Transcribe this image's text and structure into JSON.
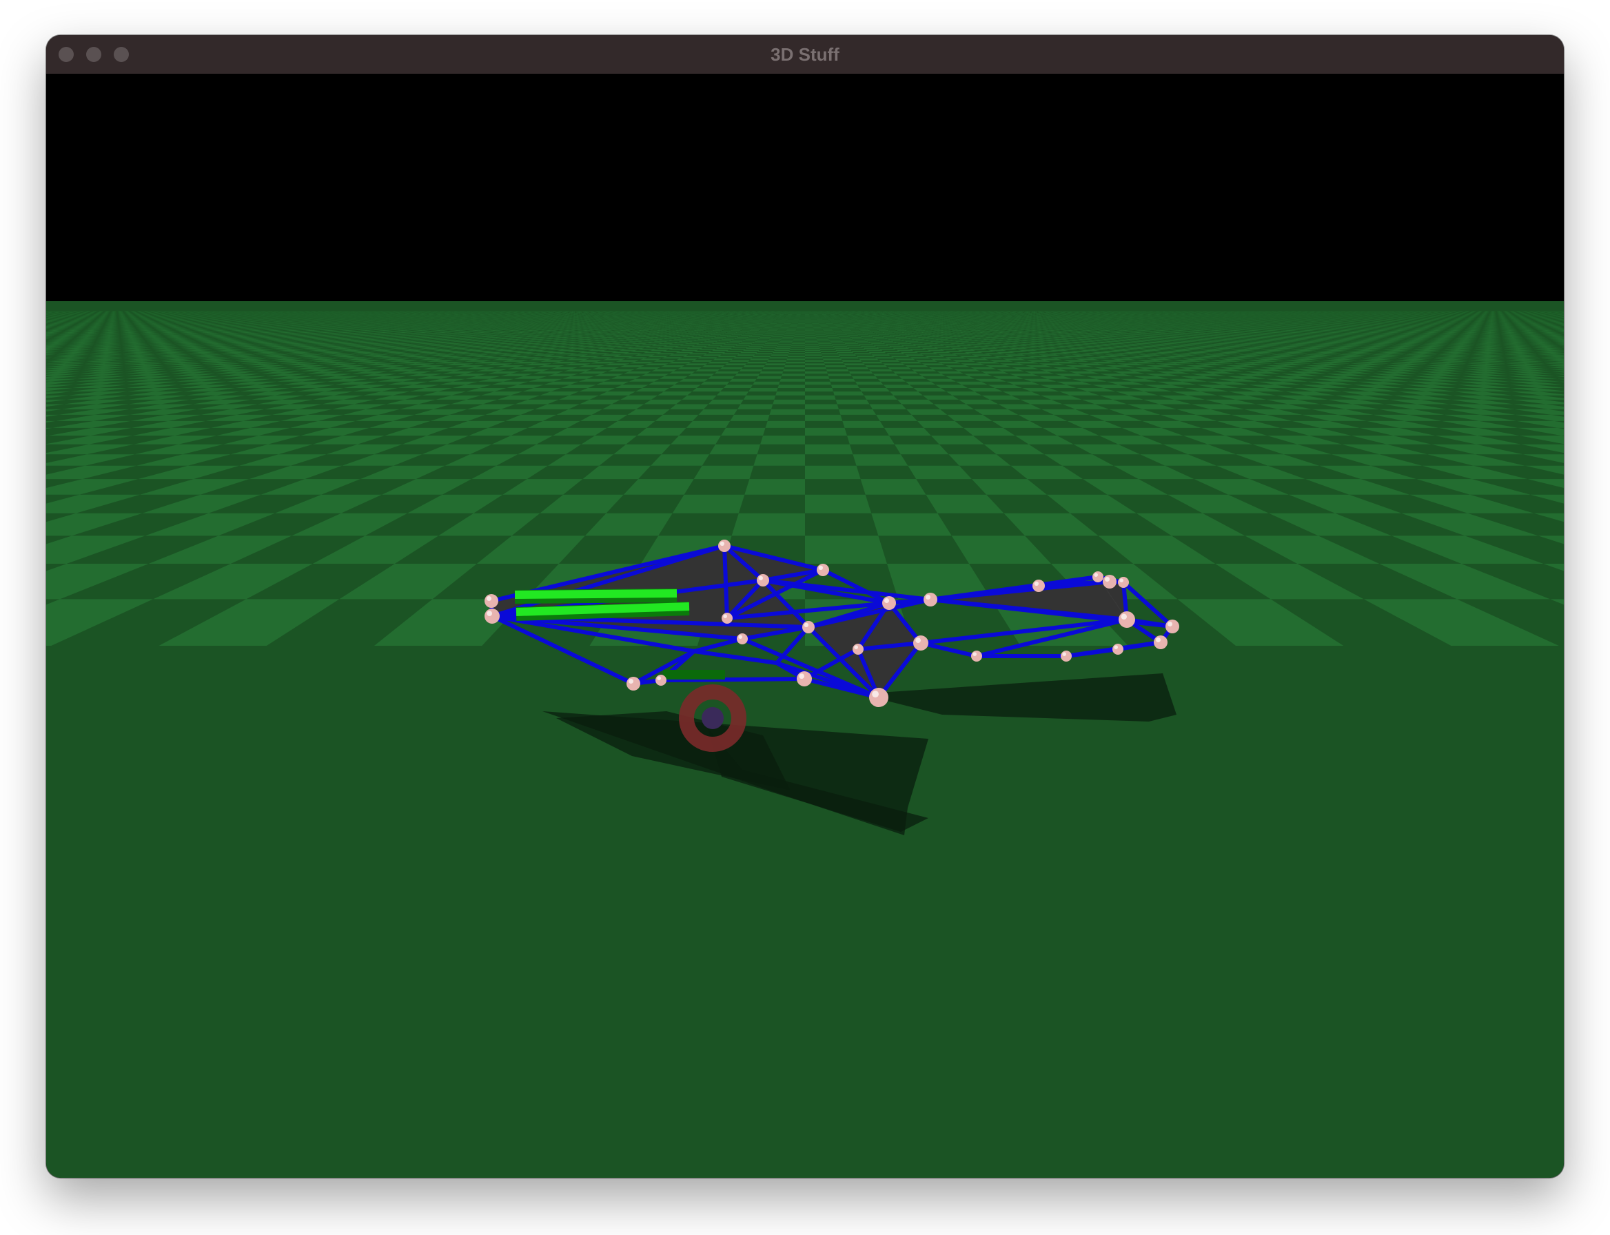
{
  "window": {
    "title": "3D Stuff",
    "traffic_lights": [
      "close",
      "minimize",
      "zoom"
    ]
  },
  "scene": {
    "sky_color": "#000000",
    "ground_colors": [
      "#1b5424",
      "#236d30"
    ],
    "strut_color": "#0a0ad8",
    "panel_color": "#333333",
    "joint_color": "#e8b4b0",
    "actuator_color": "#22e822",
    "wheel_color": "#7a2a2a",
    "shadow_color": "#0a1e0d"
  }
}
